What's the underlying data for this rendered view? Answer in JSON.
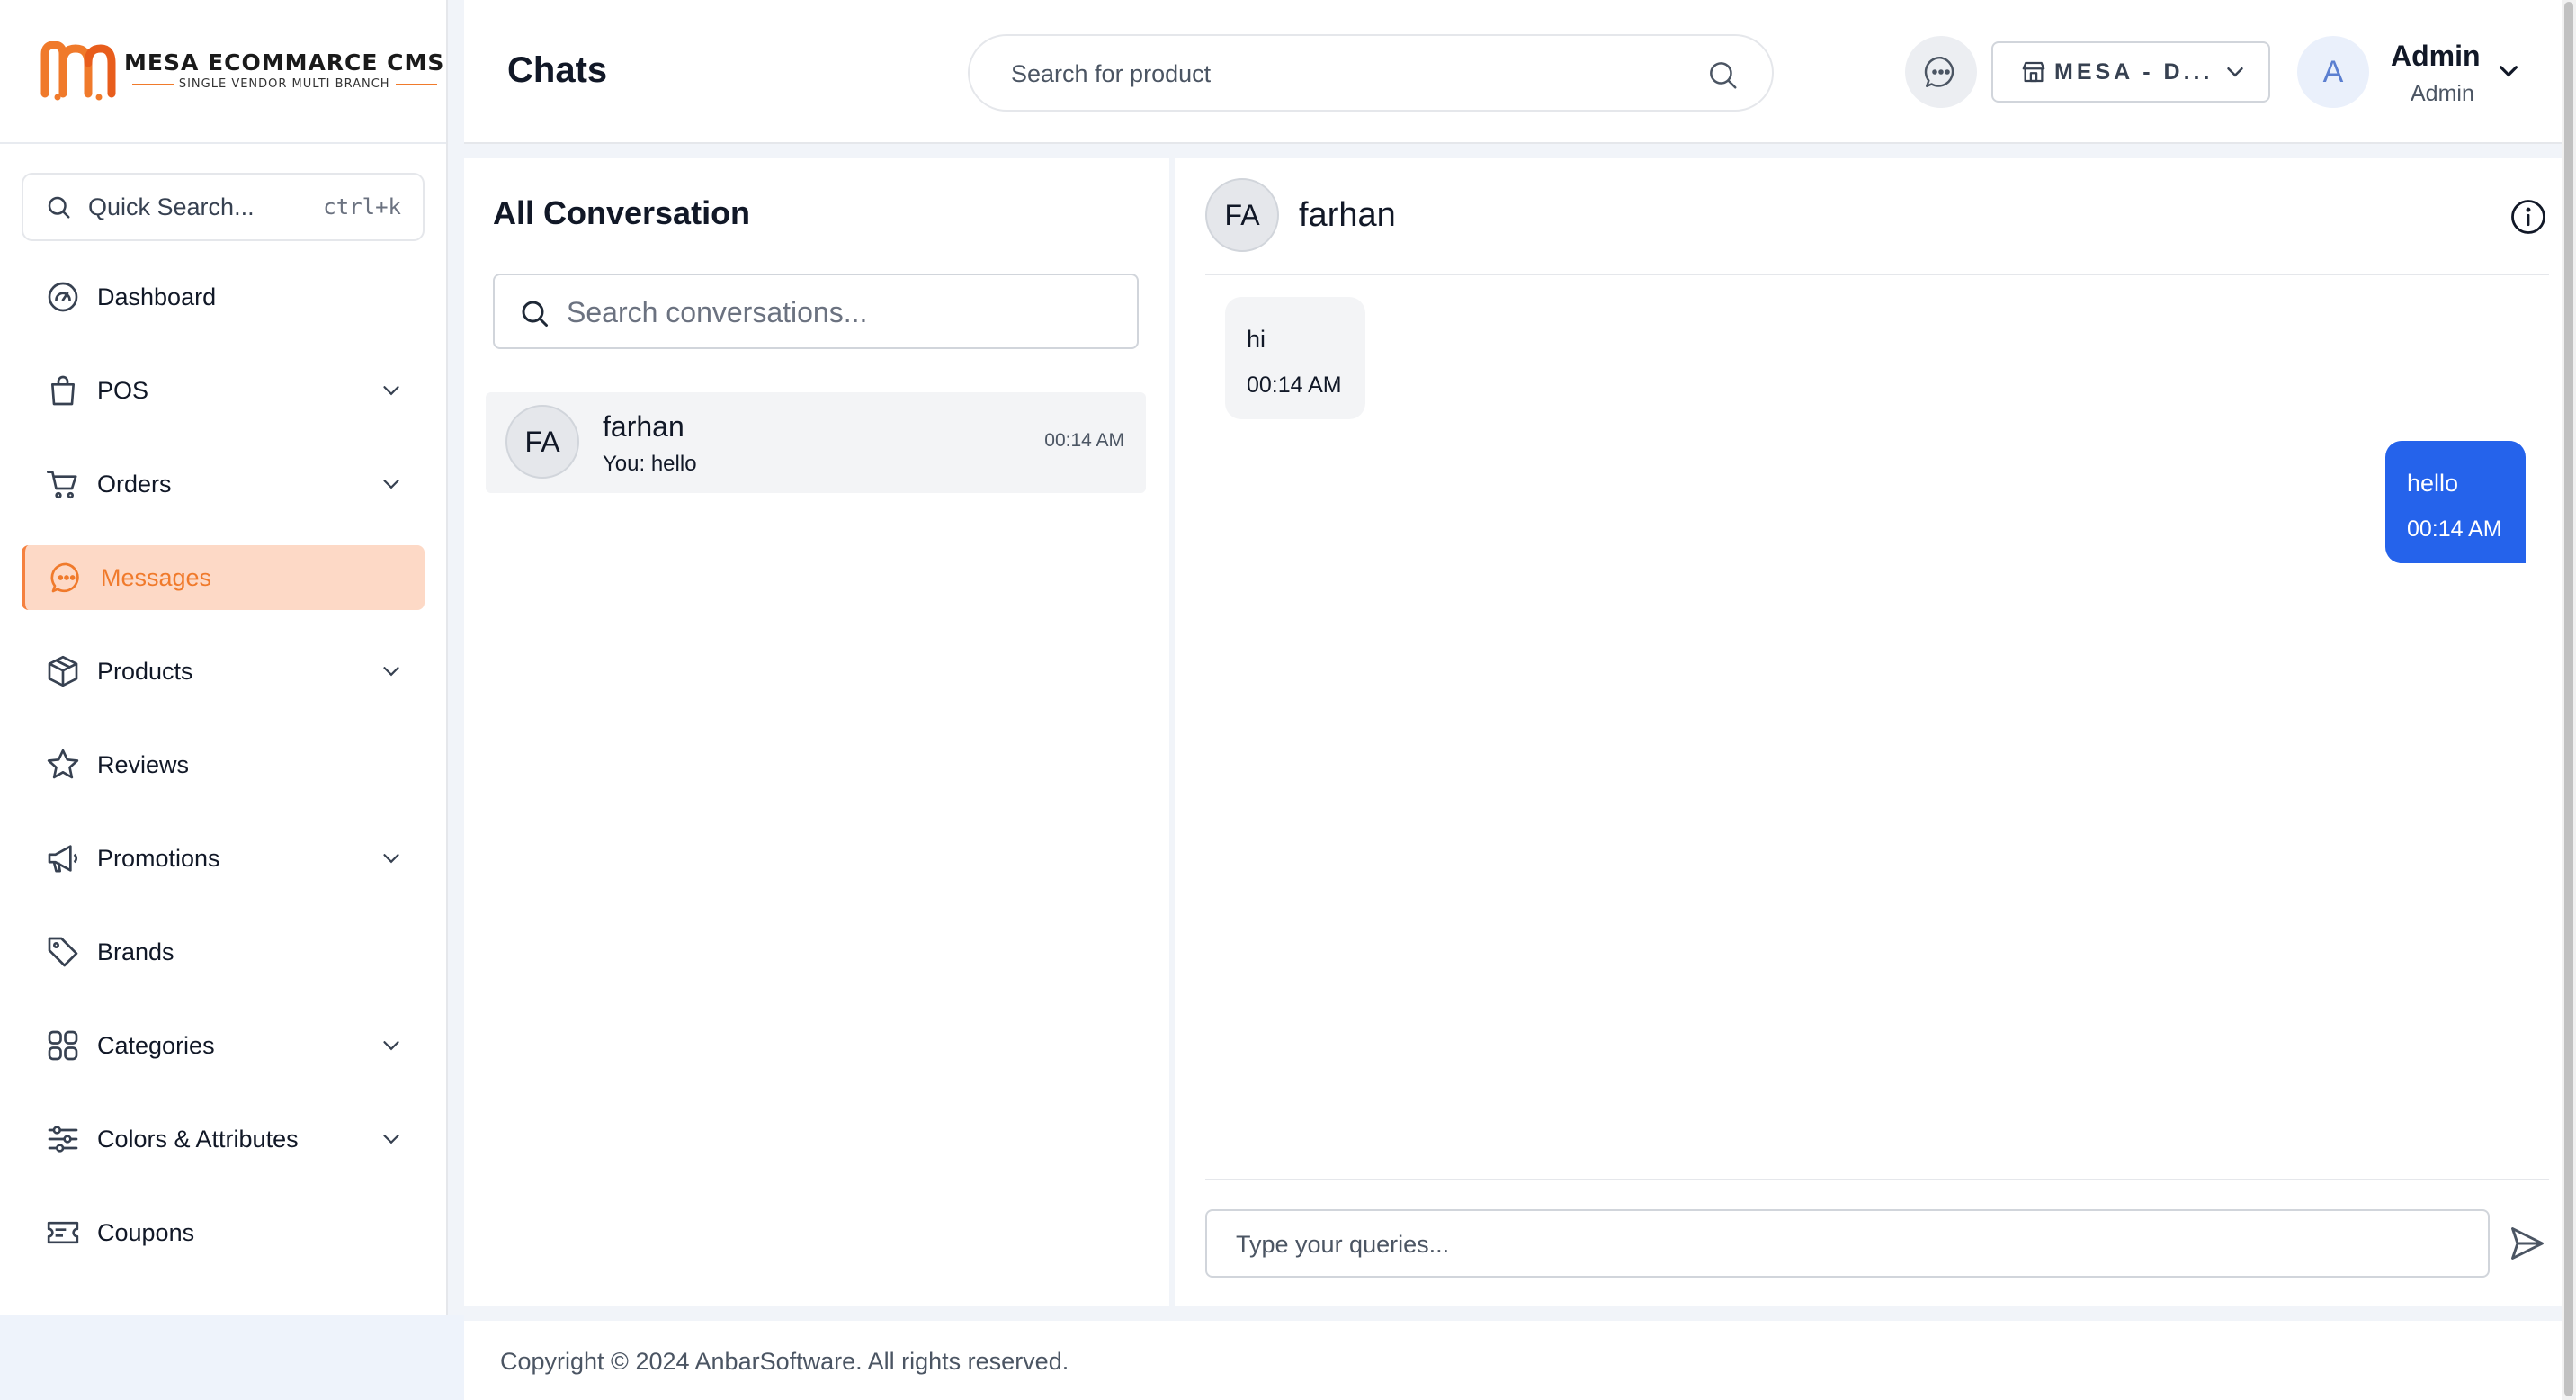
{
  "colors": {
    "accent": "#f07a2b",
    "active_bg": "#fdd9c6",
    "outgoing_bubble": "#2563eb",
    "incoming_bubble": "#f3f4f6"
  },
  "brand": {
    "title": "MESA ECOMMARCE CMS",
    "subtitle": "SINGLE VENDOR MULTI BRANCH"
  },
  "sidebar": {
    "quick_search": {
      "label": "Quick Search...",
      "shortcut": "ctrl+k"
    },
    "items": [
      {
        "label": "Dashboard",
        "icon": "dashboard-gauge-icon",
        "has_submenu": false,
        "active": false
      },
      {
        "label": "POS",
        "icon": "shopping-bag-icon",
        "has_submenu": true,
        "active": false
      },
      {
        "label": "Orders",
        "icon": "cart-icon",
        "has_submenu": true,
        "active": false
      },
      {
        "label": "Messages",
        "icon": "chat-bubble-icon",
        "has_submenu": false,
        "active": true
      },
      {
        "label": "Products",
        "icon": "box-icon",
        "has_submenu": true,
        "active": false
      },
      {
        "label": "Reviews",
        "icon": "star-icon",
        "has_submenu": false,
        "active": false
      },
      {
        "label": "Promotions",
        "icon": "megaphone-icon",
        "has_submenu": true,
        "active": false
      },
      {
        "label": "Brands",
        "icon": "tag-icon",
        "has_submenu": false,
        "active": false
      },
      {
        "label": "Categories",
        "icon": "grid-icon",
        "has_submenu": true,
        "active": false
      },
      {
        "label": "Colors & Attributes",
        "icon": "sliders-icon",
        "has_submenu": true,
        "active": false
      },
      {
        "label": "Coupons",
        "icon": "ticket-icon",
        "has_submenu": false,
        "active": false
      }
    ]
  },
  "header": {
    "title": "Chats",
    "search_placeholder": "Search for product",
    "store_selector": "MESA - D...",
    "user": {
      "initial": "A",
      "name": "Admin",
      "role": "Admin"
    }
  },
  "conversations": {
    "title": "All Conversation",
    "search_placeholder": "Search conversations...",
    "items": [
      {
        "initials": "FA",
        "name": "farhan",
        "preview": "You: hello",
        "time": "00:14 AM"
      }
    ]
  },
  "chat": {
    "contact": {
      "initials": "FA",
      "name": "farhan"
    },
    "messages": [
      {
        "direction": "incoming",
        "text": "hi",
        "time": "00:14 AM"
      },
      {
        "direction": "outgoing",
        "text": "hello",
        "time": "00:14 AM"
      }
    ],
    "input_placeholder": "Type your queries..."
  },
  "footer": {
    "copyright": "Copyright © 2024 AnbarSoftware. All rights reserved."
  }
}
